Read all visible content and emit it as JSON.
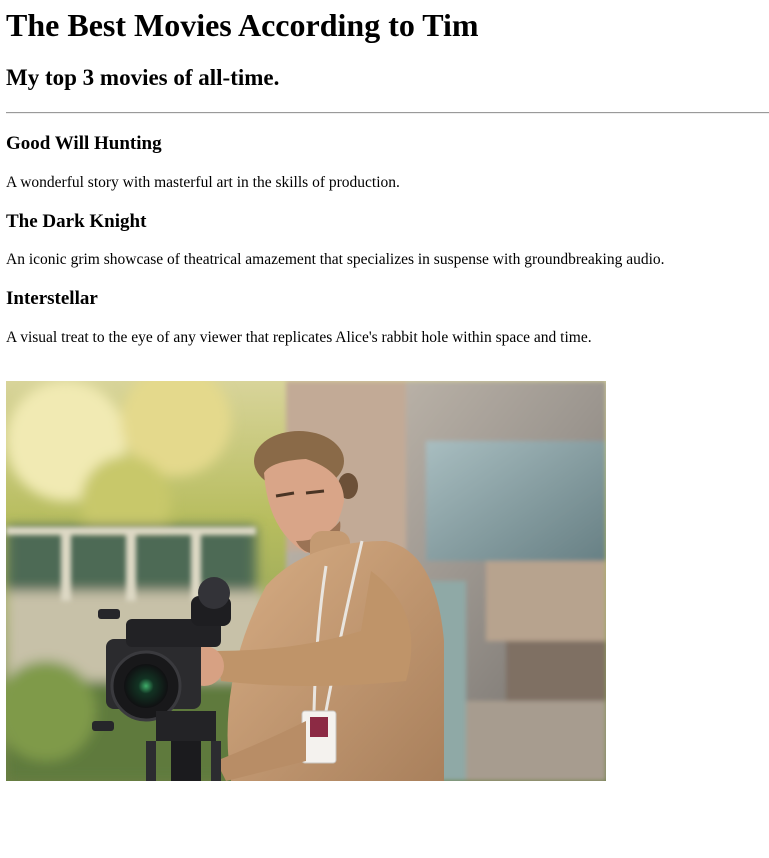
{
  "header": {
    "title": "The Best Movies According to Tim",
    "subtitle": "My top 3 movies of all-time."
  },
  "movies": [
    {
      "title": "Good Will Hunting",
      "description": "A wonderful story with masterful art in the skills of production."
    },
    {
      "title": "The Dark Knight",
      "description": "An iconic grim showcase of theatrical amazement that specializes in suspense with groundbreaking audio."
    },
    {
      "title": "Interstellar",
      "description": "A visual treat to the eye of any viewer that replicates Alice's rabbit hole within space and time."
    }
  ],
  "photo": {
    "subject": "cameraman-photo",
    "colors": {
      "foliage": "#b9bf5a",
      "sweater": "#c49a72",
      "wall": "#8d8a86",
      "camera": "#2a2a2c"
    }
  }
}
